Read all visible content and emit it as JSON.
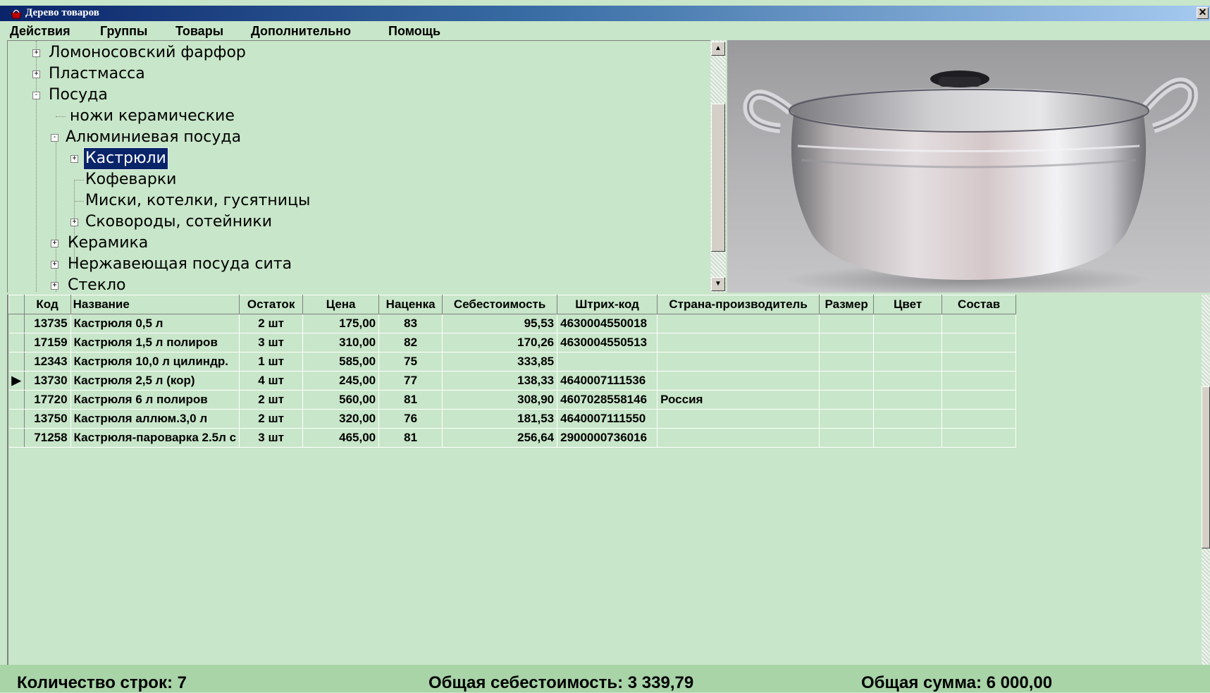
{
  "window": {
    "title": "Дерево товаров",
    "close_glyph": "✕"
  },
  "menu": [
    "Действия",
    "Группы",
    "Товары",
    "Дополнительно",
    "Помощь"
  ],
  "tree": [
    {
      "label": "Ломоносовский фарфор",
      "level": 0,
      "expander": "+"
    },
    {
      "label": "Пластмасса",
      "level": 0,
      "expander": "+"
    },
    {
      "label": "Посуда",
      "level": 0,
      "expander": "-"
    },
    {
      "label": "ножи керамические",
      "level": 1,
      "expander": ""
    },
    {
      "label": "Алюминиевая посуда",
      "level": 1,
      "expander": "-"
    },
    {
      "label": "Кастрюли",
      "level": 2,
      "expander": "+",
      "selected": true
    },
    {
      "label": "Кофеварки",
      "level": 2,
      "expander": ""
    },
    {
      "label": "Миски, котелки, гусятницы",
      "level": 2,
      "expander": ""
    },
    {
      "label": "Сковороды, сотейники",
      "level": 2,
      "expander": "+"
    },
    {
      "label": "Керамика",
      "level": 1,
      "expander": "+"
    },
    {
      "label": "Нержавеющая посуда сита",
      "level": 1,
      "expander": "+"
    },
    {
      "label": "Стекло",
      "level": 1,
      "expander": "+"
    }
  ],
  "image": {
    "icon": "cooking-pot-photo"
  },
  "grid": {
    "columns": [
      "Код",
      "Название",
      "Остаток",
      "Цена",
      "Наценка",
      "Себестоимость",
      "Штрих-код",
      "Страна-производитель",
      "Размер",
      "Цвет",
      "Состав"
    ],
    "current_row": 3,
    "rows": [
      [
        "13735",
        "Кастрюля 0,5 л",
        "2 шт",
        "175,00",
        "83",
        "95,53",
        "4630004550018",
        "",
        "",
        "",
        ""
      ],
      [
        "17159",
        "Кастрюля 1,5 л полиров",
        "3 шт",
        "310,00",
        "82",
        "170,26",
        "4630004550513",
        "",
        "",
        "",
        ""
      ],
      [
        "12343",
        "Кастрюля 10,0 л цилиндр.",
        "1 шт",
        "585,00",
        "75",
        "333,85",
        "",
        "",
        "",
        "",
        ""
      ],
      [
        "13730",
        "Кастрюля 2,5 л (кор)",
        "4 шт",
        "245,00",
        "77",
        "138,33",
        "4640007111536",
        "",
        "",
        "",
        ""
      ],
      [
        "17720",
        "Кастрюля 6 л полиров",
        "2 шт",
        "560,00",
        "81",
        "308,90",
        "4607028558146",
        "Россия",
        "",
        "",
        ""
      ],
      [
        "13750",
        "Кастрюля аллюм.3,0 л",
        "2 шт",
        "320,00",
        "76",
        "181,53",
        "4640007111550",
        "",
        "",
        "",
        ""
      ],
      [
        "71258",
        "Кастрюля-пароварка 2.5л с",
        "3 шт",
        "465,00",
        "81",
        "256,64",
        "2900000736016",
        "",
        "",
        "",
        ""
      ]
    ]
  },
  "status": {
    "rows_count": "Количество строк: 7",
    "total_cost": "Общая себестоимость: 3 339,79",
    "total_sum": "Общая сумма: 6 000,00"
  },
  "colors": {
    "background": "#c8e6c9",
    "status_bar": "#a8d4a8",
    "selection": "#0a246a",
    "title_bar": "#0a246a"
  }
}
